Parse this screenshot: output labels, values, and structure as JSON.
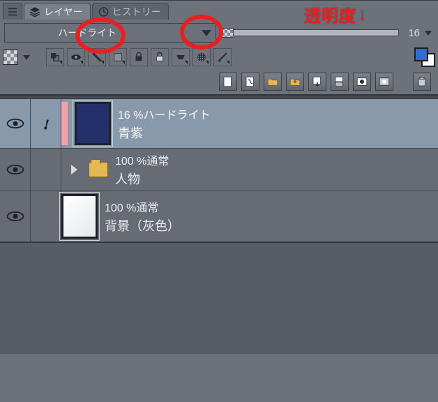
{
  "annotation": {
    "opacity_label_jp": "透明度",
    "arrow": "↓"
  },
  "tabs": {
    "layers_label": "レイヤー",
    "history_label": "ヒストリー"
  },
  "blend": {
    "mode_label": "ハードライト",
    "opacity_value": "16"
  },
  "layers": [
    {
      "id": "l0",
      "selected": true,
      "thumb": "navy",
      "info_line": "16 %ハードライト",
      "name": "青紫",
      "has_pinkbar": true,
      "has_brush_indicator": true
    },
    {
      "id": "l1",
      "is_folder": true,
      "info_line": "100 %通常",
      "name": "人物"
    },
    {
      "id": "l2",
      "thumb": "white",
      "info_line": "100 %通常",
      "name": "背景（灰色）"
    }
  ]
}
